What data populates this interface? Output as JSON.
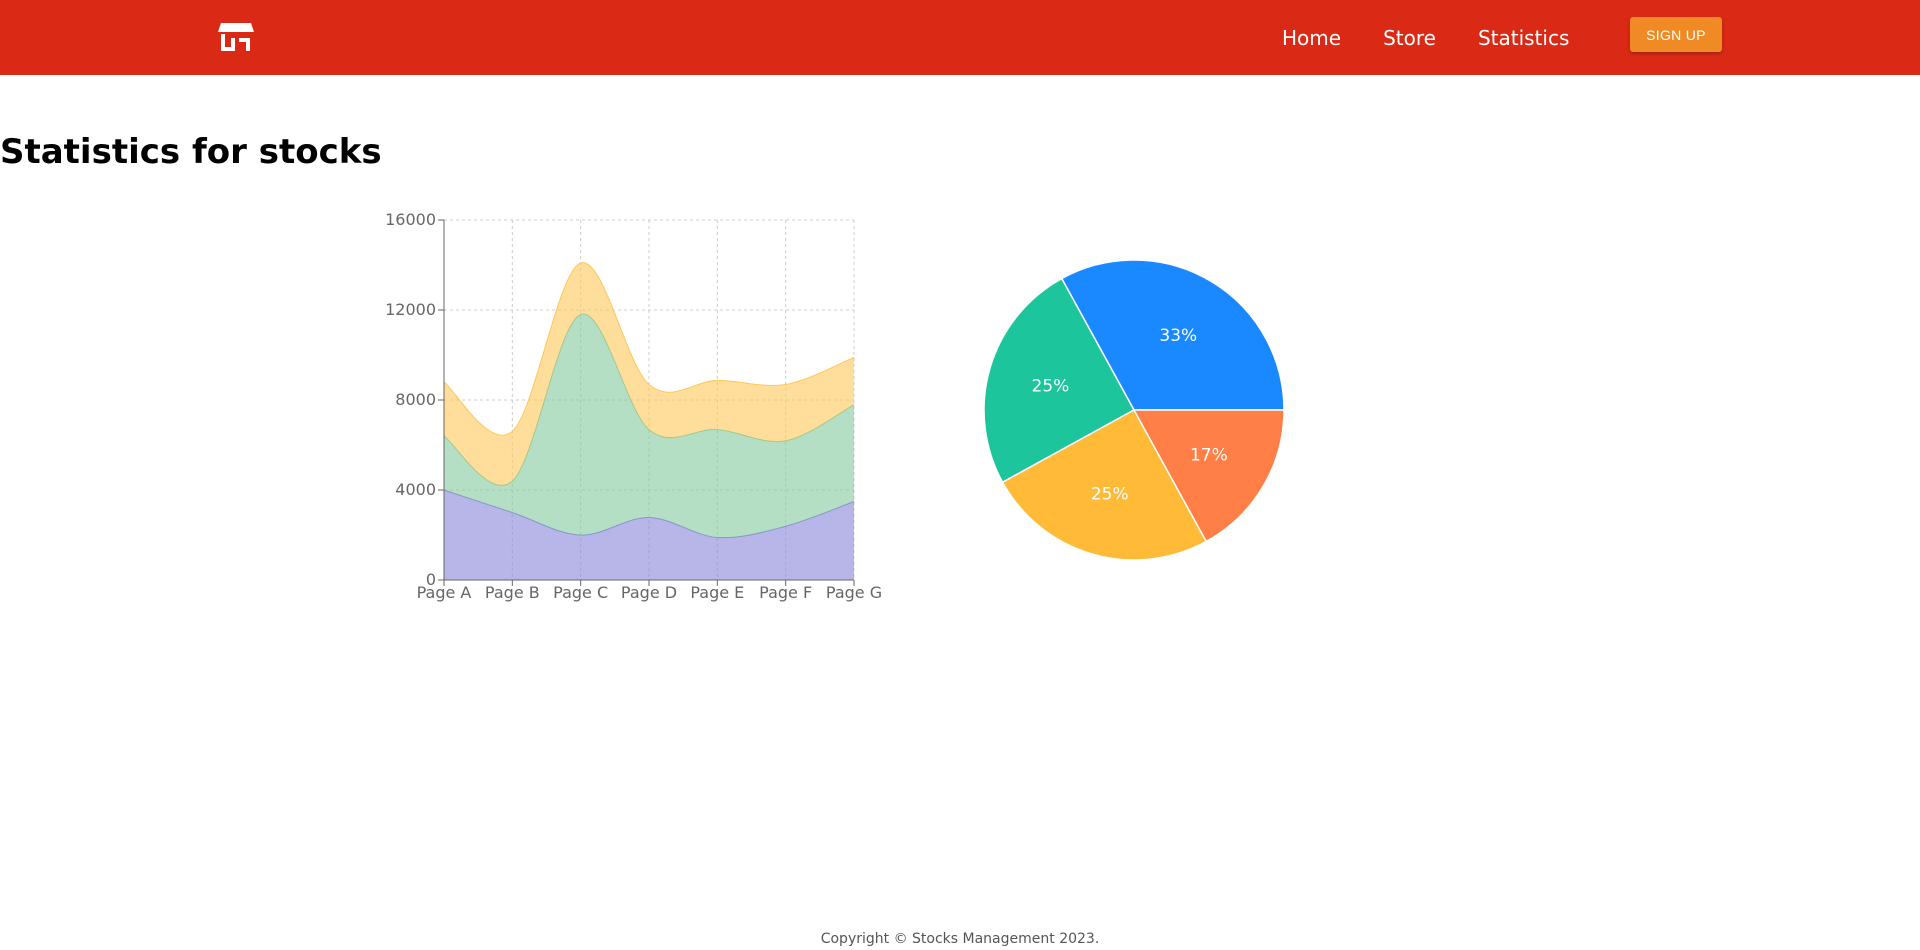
{
  "navbar": {
    "logo_icon": "storefront-icon",
    "background_color": "#da2a16",
    "links": [
      {
        "label": "Home"
      },
      {
        "label": "Store"
      },
      {
        "label": "Statistics"
      }
    ],
    "signup_label": "SIGN UP",
    "signup_color": "#f08a24"
  },
  "page": {
    "title": "Statistics for stocks"
  },
  "footer": {
    "copyright": "Copyright © Stocks Management 2023."
  },
  "chart_data": [
    {
      "type": "area",
      "stacked": true,
      "categories": [
        "Page A",
        "Page B",
        "Page C",
        "Page D",
        "Page E",
        "Page F",
        "Page G"
      ],
      "ylim": [
        0,
        16000
      ],
      "yticks": [
        0,
        4000,
        8000,
        12000,
        16000
      ],
      "grid": true,
      "series": [
        {
          "values": [
            4000,
            3000,
            2000,
            2780,
            1890,
            2390,
            3490
          ],
          "color": "#8884d8"
        },
        {
          "values": [
            2400,
            1398,
            9800,
            3908,
            4800,
            3800,
            4300
          ],
          "color": "#82ca9d"
        },
        {
          "values": [
            2400,
            2210,
            2290,
            2000,
            2181,
            2500,
            2100
          ],
          "color": "#ffc658"
        }
      ]
    },
    {
      "type": "pie",
      "values": [
        33,
        25,
        25,
        17
      ],
      "labels": [
        "33%",
        "25%",
        "25%",
        "17%"
      ],
      "colors": [
        "#1a89ff",
        "#1cc59c",
        "#ffba38",
        "#ff7f47"
      ]
    }
  ]
}
